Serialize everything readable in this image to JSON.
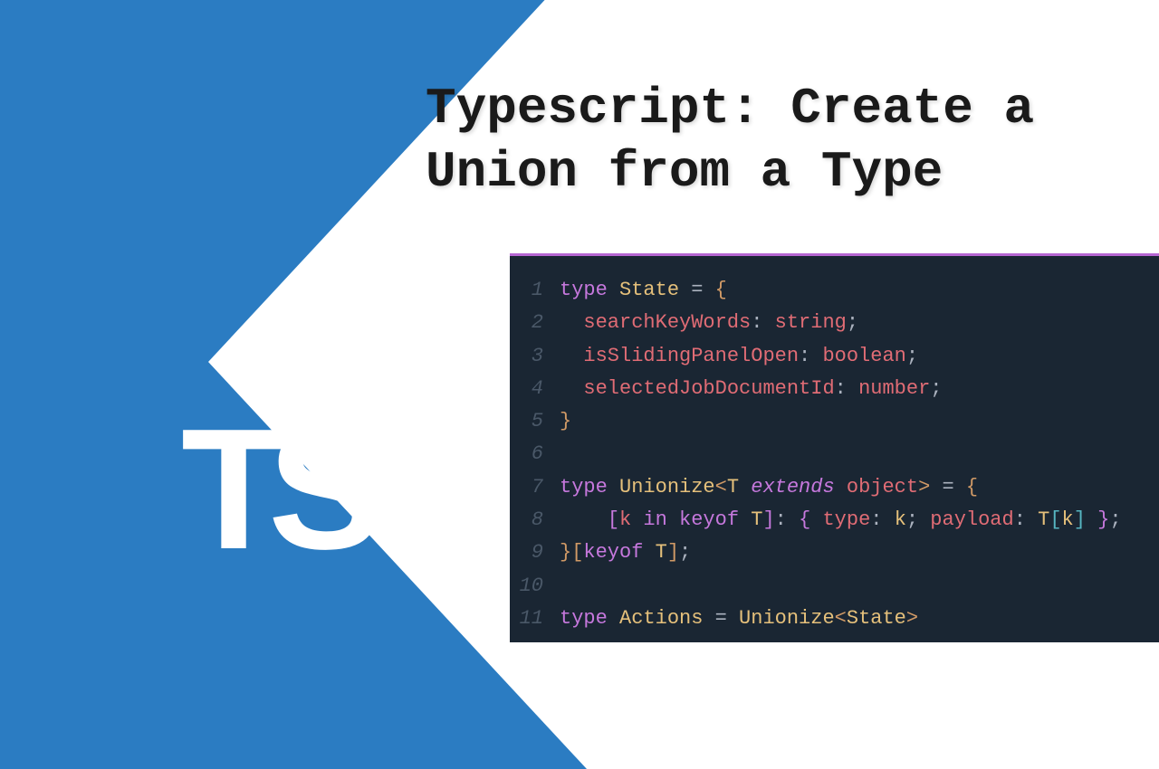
{
  "logo": "TS",
  "title": "Typescript: Create a Union from a Type",
  "code": {
    "lines": [
      {
        "n": "1",
        "tokens": [
          [
            "kw",
            "type"
          ],
          [
            "pun",
            " "
          ],
          [
            "type",
            "State"
          ],
          [
            "pun",
            " = "
          ],
          [
            "br-y",
            "{"
          ]
        ]
      },
      {
        "n": "2",
        "tokens": [
          [
            "pun",
            "  "
          ],
          [
            "prim",
            "searchKeyWords"
          ],
          [
            "pun",
            ": "
          ],
          [
            "prim",
            "string"
          ],
          [
            "pun",
            ";"
          ]
        ]
      },
      {
        "n": "3",
        "tokens": [
          [
            "pun",
            "  "
          ],
          [
            "prim",
            "isSlidingPanelOpen"
          ],
          [
            "pun",
            ": "
          ],
          [
            "prim",
            "boolean"
          ],
          [
            "pun",
            ";"
          ]
        ]
      },
      {
        "n": "4",
        "tokens": [
          [
            "pun",
            "  "
          ],
          [
            "prim",
            "selectedJobDocumentId"
          ],
          [
            "pun",
            ": "
          ],
          [
            "prim",
            "number"
          ],
          [
            "pun",
            ";"
          ]
        ]
      },
      {
        "n": "5",
        "tokens": [
          [
            "br-y",
            "}"
          ]
        ]
      },
      {
        "n": "6",
        "tokens": [
          [
            "pun",
            ""
          ]
        ]
      },
      {
        "n": "7",
        "tokens": [
          [
            "kw",
            "type"
          ],
          [
            "pun",
            " "
          ],
          [
            "type",
            "Unionize"
          ],
          [
            "br-y",
            "<"
          ],
          [
            "type",
            "T"
          ],
          [
            "pun",
            " "
          ],
          [
            "kw ital",
            "extends"
          ],
          [
            "pun",
            " "
          ],
          [
            "prim",
            "object"
          ],
          [
            "br-y",
            ">"
          ],
          [
            "pun",
            " = "
          ],
          [
            "br-y",
            "{"
          ]
        ]
      },
      {
        "n": "8",
        "tokens": [
          [
            "pun",
            "    "
          ],
          [
            "br-p",
            "["
          ],
          [
            "prim",
            "k"
          ],
          [
            "pun",
            " "
          ],
          [
            "kw",
            "in"
          ],
          [
            "pun",
            " "
          ],
          [
            "kw",
            "keyof"
          ],
          [
            "pun",
            " "
          ],
          [
            "type",
            "T"
          ],
          [
            "br-p",
            "]"
          ],
          [
            "pun",
            ": "
          ],
          [
            "br-p",
            "{"
          ],
          [
            "pun",
            " "
          ],
          [
            "prim",
            "type"
          ],
          [
            "pun",
            ": "
          ],
          [
            "type",
            "k"
          ],
          [
            "pun",
            "; "
          ],
          [
            "prim",
            "payload"
          ],
          [
            "pun",
            ": "
          ],
          [
            "type",
            "T"
          ],
          [
            "br-b",
            "["
          ],
          [
            "type",
            "k"
          ],
          [
            "br-b",
            "]"
          ],
          [
            "pun",
            " "
          ],
          [
            "br-p",
            "}"
          ],
          [
            "pun",
            ";"
          ]
        ]
      },
      {
        "n": "9",
        "tokens": [
          [
            "br-y",
            "}"
          ],
          [
            "br-y",
            "["
          ],
          [
            "kw",
            "keyof"
          ],
          [
            "pun",
            " "
          ],
          [
            "type",
            "T"
          ],
          [
            "br-y",
            "]"
          ],
          [
            "pun",
            ";"
          ]
        ]
      },
      {
        "n": "10",
        "tokens": [
          [
            "pun",
            ""
          ]
        ]
      },
      {
        "n": "11",
        "tokens": [
          [
            "kw",
            "type"
          ],
          [
            "pun",
            " "
          ],
          [
            "type",
            "Actions"
          ],
          [
            "pun",
            " = "
          ],
          [
            "type",
            "Unionize"
          ],
          [
            "br-y",
            "<"
          ],
          [
            "type",
            "State"
          ],
          [
            "br-y",
            ">"
          ]
        ]
      }
    ]
  }
}
